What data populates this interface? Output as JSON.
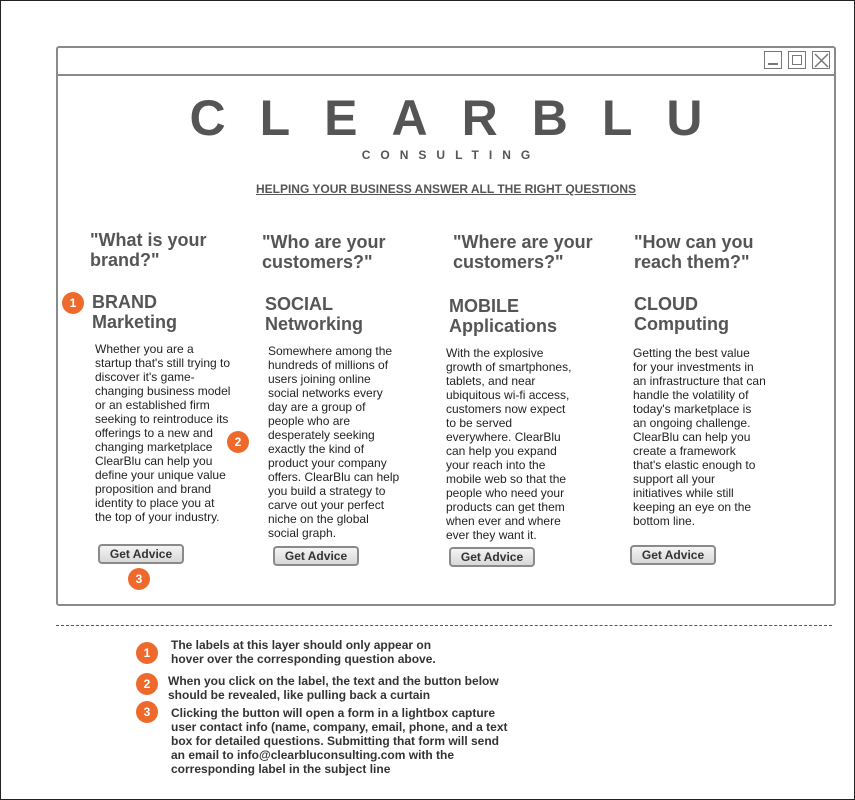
{
  "brand": {
    "logo": "CLEARBLU",
    "subtitle": "CONSULTING",
    "tagline": "HELPING YOUR BUSINESS ANSWER ALL THE RIGHT QUESTIONS"
  },
  "columns": [
    {
      "question": "\"What is your brand?\"",
      "label_line1": "BRAND",
      "label_line2": "Marketing",
      "description": "Whether you are a startup that's still trying to discover it's game-changing business model or an established firm seeking to reintroduce its offerings to a new and changing marketplace ClearBlu can help you define your unique value proposition and brand identity to place you at the top of your industry.",
      "button": "Get Advice"
    },
    {
      "question": "\"Who are your customers?\"",
      "label_line1": "SOCIAL",
      "label_line2": "Networking",
      "description": "Somewhere among the hundreds of millions of users joining online social networks every day are a group of people who are desperately seeking exactly the kind of product your company offers. ClearBlu can help you build a strategy to carve out your perfect niche on the global social graph.",
      "button": "Get Advice"
    },
    {
      "question": "\"Where are your customers?\"",
      "label_line1": "MOBILE",
      "label_line2": "Applications",
      "description": "With the explosive growth of smartphones, tablets, and near ubiquitous wi-fi access, customers now expect to be served everywhere.  ClearBlu can help you expand your reach into the mobile web so that the people who need your products can get them when ever and where ever they want it.",
      "button": "Get Advice"
    },
    {
      "question": "\"How can you reach them?\"",
      "label_line1": "CLOUD",
      "label_line2": "Computing",
      "description": "Getting the best value for your investments in an infrastructure that can handle the volatility of today's marketplace is an ongoing challenge. ClearBlu can help you create a framework that's elastic enough to support all your initiatives while still keeping an eye on the bottom line.",
      "button": "Get Advice"
    }
  ],
  "badges": [
    "1",
    "2",
    "3"
  ],
  "notes": [
    {
      "num": "1",
      "text": "The labels at this layer should only appear on hover over the corresponding question above."
    },
    {
      "num": "2",
      "text": "When you click on the label, the text and the button below should be revealed, like pulling back a curtain"
    },
    {
      "num": "3",
      "text": "Clicking the button will open a form in a lightbox  capture user contact info (name, company, email, phone, and a text box for detailed questions.  Submitting that form will  send an email to info@clearbluconsulting.com with the corresponding label in the subject line"
    }
  ],
  "colors": {
    "badge": "#ee6a2c",
    "frame": "#8a8a8a",
    "text": "#555555"
  }
}
